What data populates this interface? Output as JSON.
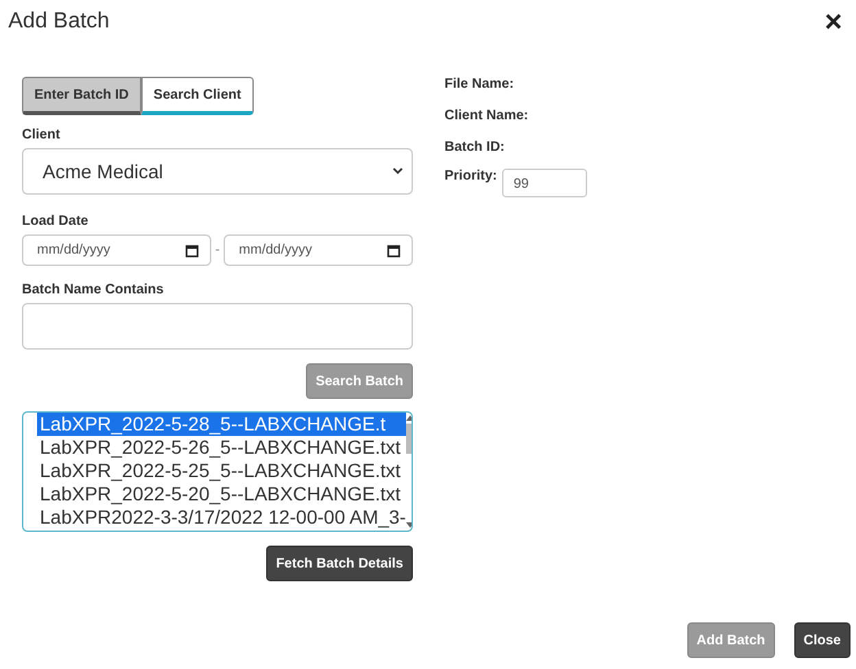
{
  "dialog": {
    "title": "Add Batch",
    "close": "×"
  },
  "tabs": [
    {
      "label": "Enter Batch ID",
      "selected": false
    },
    {
      "label": "Search Client",
      "selected": true
    }
  ],
  "client": {
    "label": "Client",
    "value": "Acme Medical"
  },
  "load_date": {
    "label": "Load Date",
    "from_placeholder": "mm/dd/yyyy",
    "separator": "-",
    "to_placeholder": "mm/dd/yyyy"
  },
  "batch_name": {
    "label": "Batch Name Contains"
  },
  "search_button": {
    "label": "Search Batch",
    "disabled": true
  },
  "batch_list": [
    {
      "name": "LabXPR_2022-5-28_5--LABXCHANGE.t",
      "selected": true
    },
    {
      "name": "LabXPR_2022-5-26_5--LABXCHANGE.txt",
      "selected": false
    },
    {
      "name": "LabXPR_2022-5-25_5--LABXCHANGE.txt",
      "selected": false
    },
    {
      "name": "LabXPR_2022-5-20_5--LABXCHANGE.txt",
      "selected": false
    },
    {
      "name": "LabXPR2022-3-3/17/2022 12-00-00 AM_3-",
      "selected": false
    }
  ],
  "fetch_button": {
    "label": "Fetch Batch Details",
    "disabled": false
  },
  "details": {
    "file_name": "File Name:",
    "client_name": "Client Name:",
    "batch_id": "Batch ID:",
    "priority_label": "Priority:",
    "priority_value": "99"
  },
  "footer_buttons": [
    {
      "label": "Add Batch",
      "disabled": true
    },
    {
      "label": "Close",
      "disabled": false
    }
  ]
}
